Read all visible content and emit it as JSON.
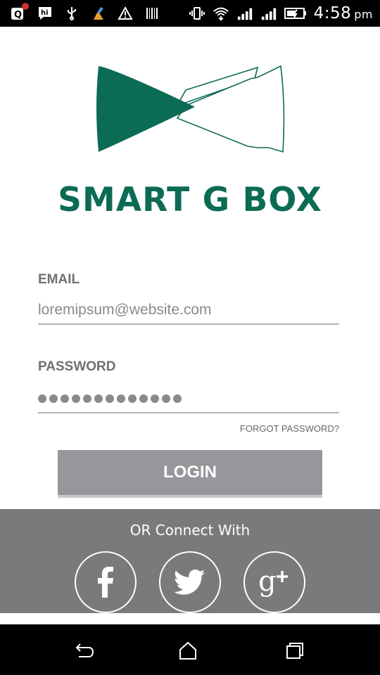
{
  "status_bar": {
    "left_icons": [
      "quora-notification-icon",
      "hike-messenger-icon",
      "usb-icon",
      "cleaner-icon",
      "warning-icon",
      "barcode-icon"
    ],
    "right_icons": [
      "vibrate-icon",
      "wifi-icon",
      "signal-1-icon",
      "signal-2-icon",
      "battery-charging-icon"
    ],
    "time": "4:58",
    "ampm": "pm",
    "notification_badge_color": "#d32f2f"
  },
  "brand": {
    "name": "SMART G BOX",
    "color": "#0c6b55"
  },
  "form": {
    "email_label": "EMAIL",
    "email_value": "loremipsum@website.com",
    "password_label": "PASSWORD",
    "password_mask_length": 13,
    "forgot_label": "FORGOT PASSWORD?",
    "login_label": "LOGIN",
    "login_color": "#96979b"
  },
  "social": {
    "title": "OR Connect With",
    "panel_color": "#7a7a7a",
    "buttons": [
      {
        "name": "facebook",
        "icon": "facebook-icon"
      },
      {
        "name": "twitter",
        "icon": "twitter-icon"
      },
      {
        "name": "google-plus",
        "icon": "google-plus-icon"
      }
    ]
  },
  "nav": {
    "icons": [
      "back-icon",
      "home-icon",
      "recent-apps-icon"
    ]
  }
}
